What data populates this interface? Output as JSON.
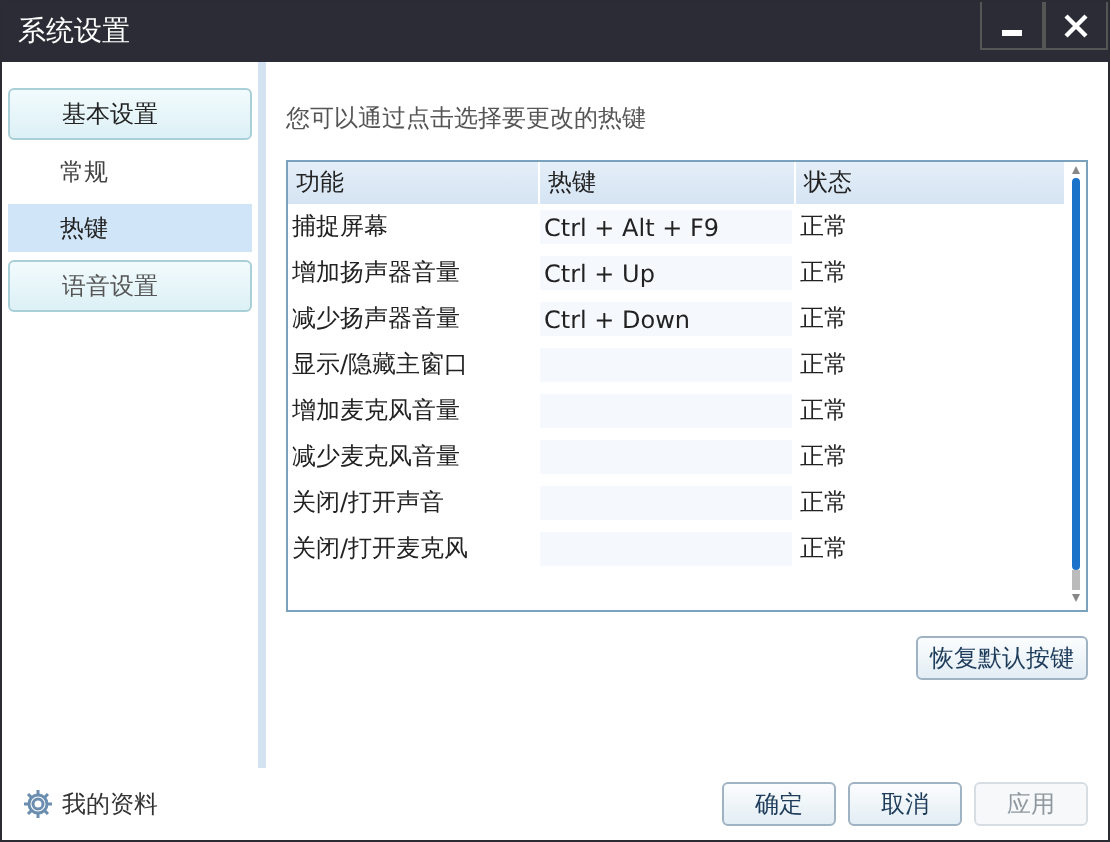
{
  "window": {
    "title": "系统设置",
    "controls": [
      {
        "kind": "minimize"
      },
      {
        "kind": "close"
      }
    ]
  },
  "sidebar": {
    "groups": [
      {
        "label": "基本设置",
        "expanded": true,
        "children": [
          {
            "label": "常规",
            "selected": false
          },
          {
            "label": "热键",
            "selected": true
          }
        ]
      },
      {
        "label": "语音设置",
        "expanded": false
      }
    ],
    "footer_link": "我的资料"
  },
  "content": {
    "hint": "您可以通过点击选择要更改的热键",
    "table": {
      "columns": [
        "功能",
        "热键",
        "状态"
      ],
      "rows": [
        {
          "function": "捕捉屏幕",
          "hotkey": "Ctrl + Alt + F9",
          "status": "正常"
        },
        {
          "function": "增加扬声器音量",
          "hotkey": "Ctrl + Up",
          "status": "正常"
        },
        {
          "function": "减少扬声器音量",
          "hotkey": "Ctrl + Down",
          "status": "正常"
        },
        {
          "function": "显示/隐藏主窗口",
          "status": "正常"
        },
        {
          "function": "增加麦克风音量",
          "status": "正常"
        },
        {
          "function": "减少麦克风音量",
          "status": "正常"
        },
        {
          "function": "关闭/打开声音",
          "status": "正常"
        },
        {
          "function": "关闭/打开麦克风",
          "status": "正常"
        }
      ]
    },
    "restore_button": "恢复默认按键"
  },
  "buttons": [
    {
      "label": "确定",
      "disabled": false
    },
    {
      "label": "取消",
      "disabled": false
    },
    {
      "label": "应用",
      "disabled": true
    }
  ]
}
